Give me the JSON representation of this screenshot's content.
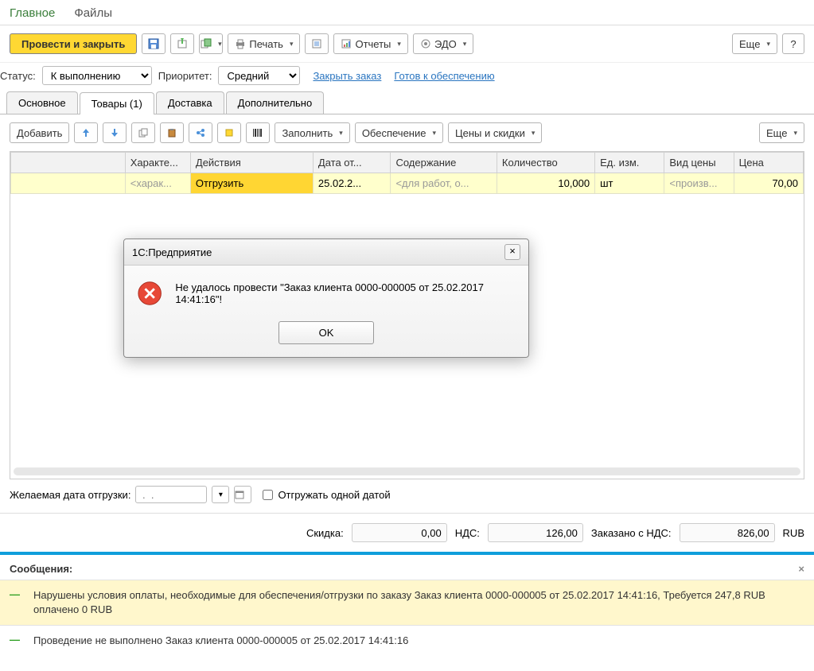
{
  "top_tabs": {
    "main": "Главное",
    "files": "Файлы"
  },
  "toolbar": {
    "post_close": "Провести и закрыть",
    "print": "Печать",
    "reports": "Отчеты",
    "edo": "ЭДО",
    "more": "Еще",
    "help": "?"
  },
  "filter": {
    "status_label": "Статус:",
    "status_value": "К выполнению",
    "priority_label": "Приоритет:",
    "priority_value": "Средний",
    "close_order": "Закрыть заказ",
    "ready_supply": "Готов к обеспечению"
  },
  "tabs2": {
    "basic": "Основное",
    "goods": "Товары (1)",
    "delivery": "Доставка",
    "extra": "Дополнительно"
  },
  "toolbar2": {
    "add": "Добавить",
    "fill": "Заполнить",
    "supply": "Обеспечение",
    "prices": "Цены и скидки",
    "more": "Еще"
  },
  "grid": {
    "headers": {
      "characteristic": "Характе...",
      "actions": "Действия",
      "ship_date": "Дата от...",
      "content": "Содержание",
      "quantity": "Количество",
      "unit": "Ед. изм.",
      "price_type": "Вид цены",
      "price": "Цена"
    },
    "row": {
      "characteristic": "<харак...",
      "actions": "Отгрузить",
      "ship_date": "25.02.2...",
      "content": "<для работ, о...",
      "quantity": "10,000",
      "unit": "шт",
      "price_type": "<произв...",
      "price": "70,00"
    }
  },
  "ship": {
    "label": "Желаемая дата отгрузки:",
    "date_placeholder": " .  .    ",
    "single_date": "Отгружать одной датой"
  },
  "totals": {
    "discount_label": "Скидка:",
    "discount_value": "0,00",
    "vat_label": "НДС:",
    "vat_value": "126,00",
    "ordered_vat_label": "Заказано с НДС:",
    "ordered_vat_value": "826,00",
    "currency": "RUB"
  },
  "messages": {
    "header": "Сообщения:",
    "items": [
      "Нарушены условия оплаты, необходимые для обеспечения/отгрузки по заказу Заказ клиента 0000-000005 от 25.02.2017 14:41:16, Требуется 247,8 RUB оплачено 0 RUB",
      "Проведение не выполнено Заказ клиента 0000-000005 от 25.02.2017 14:41:16"
    ]
  },
  "dialog": {
    "title": "1С:Предприятие",
    "text": "Не удалось провести \"Заказ клиента 0000-000005 от 25.02.2017 14:41:16\"!",
    "ok": "OK"
  },
  "icons": {
    "save": "save-icon",
    "post": "post-icon",
    "copy_mode": "copy-mode-icon",
    "printer": "printer-icon",
    "list": "list-icon",
    "reports": "reports-icon",
    "edo": "edo-icon",
    "up": "arrow-up-icon",
    "down": "arrow-down-icon",
    "copy": "copy-icon",
    "paste": "paste-icon",
    "share": "share-icon",
    "note": "note-icon",
    "barcode": "barcode-icon"
  }
}
